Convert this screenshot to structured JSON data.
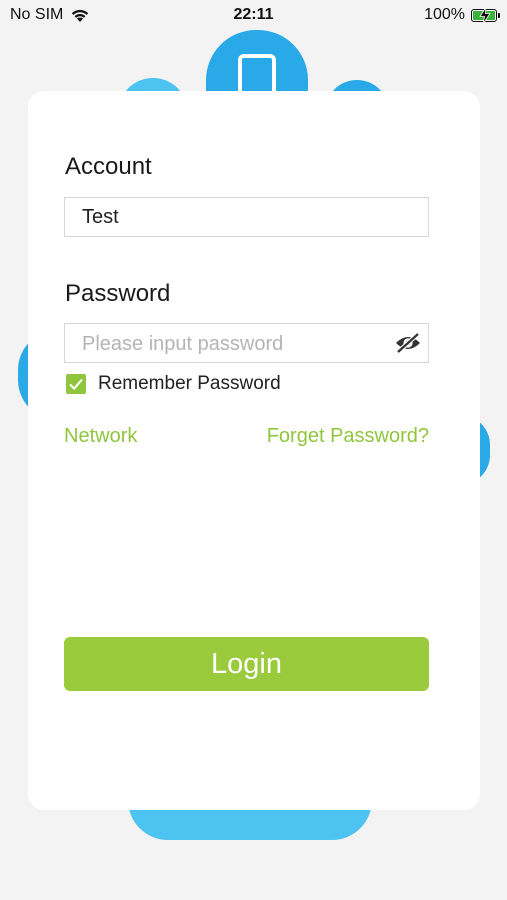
{
  "status_bar": {
    "carrier": "No SIM",
    "time": "22:11",
    "battery_percent": "100%",
    "battery_level": 1.0
  },
  "login": {
    "account_label": "Account",
    "account_value": "Test",
    "password_label": "Password",
    "password_placeholder": "Please input password",
    "remember_label": "Remember Password",
    "remember_checked": true,
    "network_link": "Network",
    "forget_link": "Forget Password?",
    "login_button": "Login"
  },
  "icons": {
    "wifi": "wifi-icon",
    "battery": "battery-charging-icon",
    "visibility": "eye-slash-icon",
    "checkmark": "checkmark-icon",
    "logo": "phone-icon"
  },
  "colors": {
    "accent_green": "#9acb3c",
    "link_green": "#8fc63e",
    "brand_blue": "#29a9e8",
    "light_blue": "#4cc3f1",
    "battery_green": "#3cb13c"
  }
}
